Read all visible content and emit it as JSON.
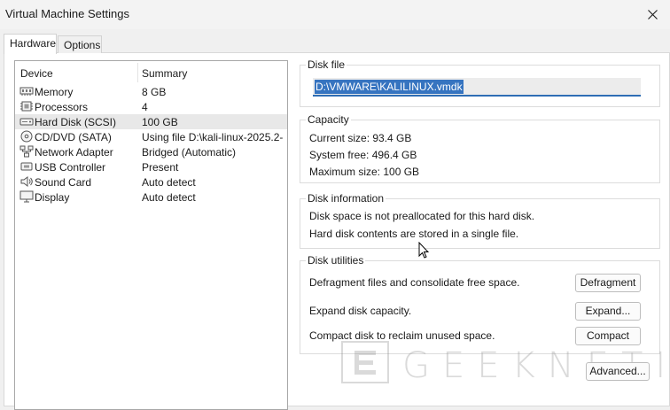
{
  "window": {
    "title": "Virtual Machine Settings"
  },
  "tabs": [
    {
      "label": "Hardware",
      "active": true
    },
    {
      "label": "Options",
      "active": false
    }
  ],
  "device_list": {
    "columns": {
      "device": "Device",
      "summary": "Summary"
    },
    "rows": [
      {
        "icon": "memory-icon",
        "name": "Memory",
        "summary": "8 GB",
        "selected": false
      },
      {
        "icon": "processor-icon",
        "name": "Processors",
        "summary": "4",
        "selected": false
      },
      {
        "icon": "hard-disk-icon",
        "name": "Hard Disk (SCSI)",
        "summary": "100 GB",
        "selected": true
      },
      {
        "icon": "cd-dvd-icon",
        "name": "CD/DVD (SATA)",
        "summary": "Using file D:\\kali-linux-2025.2-...",
        "selected": false
      },
      {
        "icon": "network-adapter-icon",
        "name": "Network Adapter",
        "summary": "Bridged (Automatic)",
        "selected": false
      },
      {
        "icon": "usb-controller-icon",
        "name": "USB Controller",
        "summary": "Present",
        "selected": false
      },
      {
        "icon": "sound-card-icon",
        "name": "Sound Card",
        "summary": "Auto detect",
        "selected": false
      },
      {
        "icon": "display-icon",
        "name": "Display",
        "summary": "Auto detect",
        "selected": false
      }
    ]
  },
  "disk_file": {
    "label": "Disk file",
    "value": "D:\\VMWARE\\KALILINUX.vmdk"
  },
  "capacity": {
    "label": "Capacity",
    "current_size": "Current size:  93.4 GB",
    "system_free": "System free:  496.4 GB",
    "maximum_size": "Maximum size:  100 GB"
  },
  "disk_information": {
    "label": "Disk information",
    "line1": "Disk space is not preallocated for this hard disk.",
    "line2": "Hard disk contents are stored in a single file."
  },
  "disk_utilities": {
    "label": "Disk utilities",
    "defrag_text": "Defragment files and consolidate free space.",
    "defrag_button": "Defragment",
    "expand_text": "Expand disk capacity.",
    "expand_button": "Expand...",
    "compact_text": "Compact disk to reclaim unused space.",
    "compact_button": "Compact"
  },
  "advanced_button": "Advanced...",
  "watermark": "GEEKNETIC",
  "colors": {
    "selection": "#3674c0",
    "input_underline": "#2e6db4",
    "row_selected": "#e8e8e8"
  }
}
